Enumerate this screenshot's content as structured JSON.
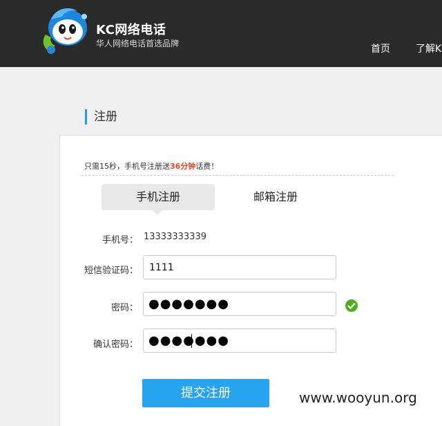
{
  "header": {
    "brand_title": "KC网络电话",
    "brand_subtitle": "华人网络电话首选品牌",
    "nav": {
      "home": "首页",
      "about": "了解K"
    }
  },
  "page": {
    "heading": "注册"
  },
  "promo": {
    "prefix": "只需15秒，手机号注册送",
    "highlight": "36分钟",
    "suffix": "话费！"
  },
  "tabs": {
    "phone": "手机注册",
    "email": "邮箱注册"
  },
  "form": {
    "phone_label": "手机号：",
    "phone_value": "13333333339",
    "sms_label": "短信验证码：",
    "sms_value": "1111",
    "password_label": "密码：",
    "password_mask": "●●●●●●●",
    "confirm_label": "确认密码：",
    "confirm_mask": "●●●●●●●",
    "submit_label": "提交注册"
  },
  "watermark": "www.wooyun.org",
  "colors": {
    "accent": "#27a4ef",
    "highlight": "#e8431c",
    "valid": "#4caf1b",
    "header_bg": "#2b2b2b"
  },
  "icons": {
    "logo": "kc-mascot-logo",
    "valid": "check-icon"
  }
}
